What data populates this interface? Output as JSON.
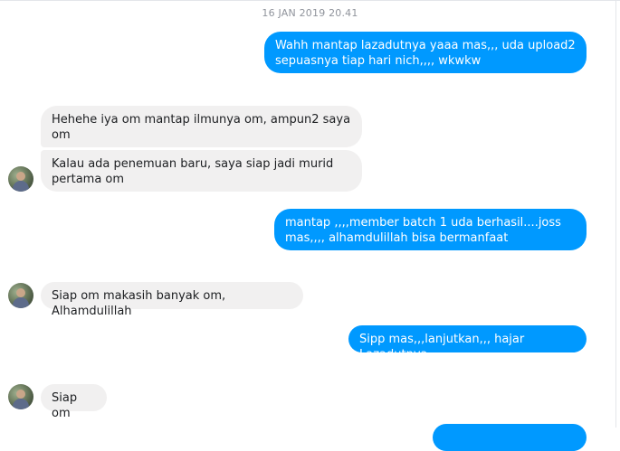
{
  "chat": {
    "timestamp": "16 JAN 2019 20.41",
    "messages": [
      {
        "side": "out",
        "text": "Wahh mantap lazadutnya yaaa mas,,, uda upload2 sepuasnya tiap hari nich,,,, wkwkw"
      },
      {
        "side": "in",
        "text": "Hehehe iya om mantap ilmunya om, ampun2 saya om"
      },
      {
        "side": "in",
        "text": "Kalau ada penemuan baru, saya siap jadi murid pertama om"
      },
      {
        "side": "out",
        "text": "mantap ,,,,member batch 1 uda berhasil....joss mas,,,, alhamdulillah bisa bermanfaat"
      },
      {
        "side": "in",
        "text": "Siap om makasih banyak om, Alhamdulillah"
      },
      {
        "side": "out",
        "text": "Sipp mas,,,lanjutkan,,, hajar Lazadutnya"
      },
      {
        "side": "in",
        "text": "Siap om"
      }
    ]
  },
  "colors": {
    "outgoing_bubble": "#0099ff",
    "incoming_bubble": "#f1f0f0"
  },
  "icons": {
    "avatar": "contact-avatar-photo"
  }
}
